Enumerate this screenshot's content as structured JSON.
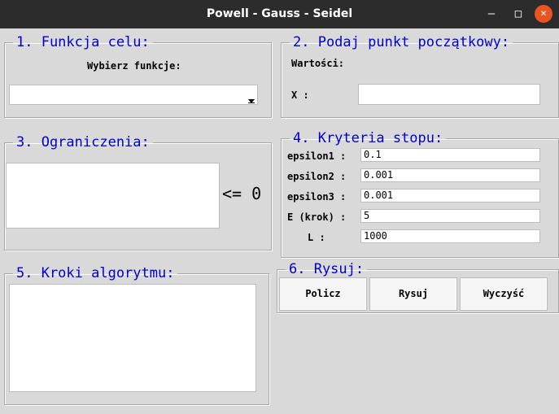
{
  "window": {
    "title": "Powell - Gauss - Seidel"
  },
  "icons": {
    "minimize": "minimize-icon",
    "maximize": "maximize-icon",
    "close": "close-icon",
    "dropdown": "chevron-down-icon"
  },
  "section1": {
    "legend": "1. Funkcja celu:",
    "label": "Wybierz funkcje:",
    "select_value": ""
  },
  "section2": {
    "legend": "2. Podaj punkt początkowy:",
    "values_label": "Wartości:",
    "x_label": "X :",
    "x_value": ""
  },
  "section3": {
    "legend": "3. Ograniczenia:",
    "operator": "<= 0",
    "value": ""
  },
  "section4": {
    "legend": "4. Kryteria stopu:",
    "rows": [
      {
        "label": "epsilon1 :",
        "value": "0.1"
      },
      {
        "label": "epsilon2 :",
        "value": "0.001"
      },
      {
        "label": "epsilon3 :",
        "value": "0.001"
      },
      {
        "label": "E (krok) :",
        "value": "5"
      },
      {
        "label": "L :",
        "value": "1000"
      }
    ]
  },
  "section5": {
    "legend": "5. Kroki algorytmu:",
    "value": ""
  },
  "section6": {
    "legend": "6. Rysuj:",
    "buttons": [
      "Policz",
      "Rysuj",
      "Wyczyść"
    ]
  },
  "colors": {
    "titlebar": "#2c2c2c",
    "close": "#e95420",
    "legend": "#0000cc",
    "background": "#d9d9d9"
  }
}
